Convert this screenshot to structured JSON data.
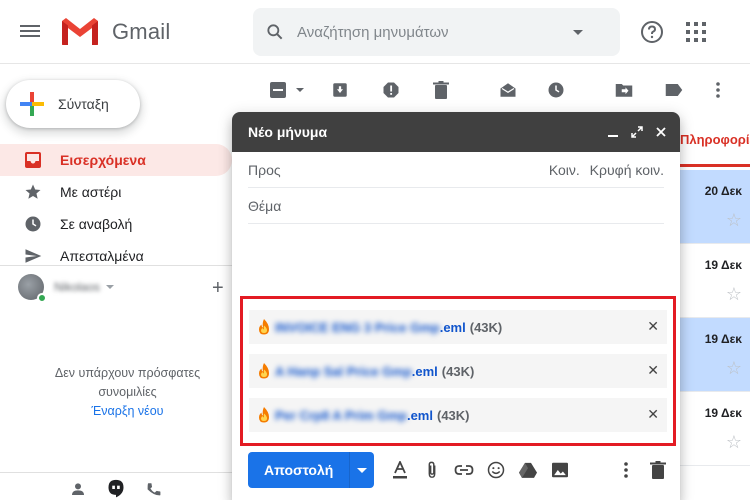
{
  "header": {
    "logo_text": "Gmail",
    "search_placeholder": "Αναζήτηση μηνυμάτων"
  },
  "nav": {
    "compose_label": "Σύνταξη",
    "items": [
      {
        "label": "Εισερχόμενα",
        "icon": "inbox-icon",
        "active": true
      },
      {
        "label": "Με αστέρι",
        "icon": "star-icon",
        "active": false
      },
      {
        "label": "Σε αναβολή",
        "icon": "clock-icon",
        "active": false
      },
      {
        "label": "Απεσταλμένα",
        "icon": "send-icon",
        "active": false
      }
    ]
  },
  "hangouts": {
    "user_name": "Nikolaos",
    "no_chats_text": "Δεν υπάρχουν πρόσφατες συνομιλίες",
    "start_new": "Έναρξη νέου"
  },
  "list": {
    "tab_label": "Πληροφορίες",
    "rows": [
      {
        "date": "20 Δεκ",
        "selected": true
      },
      {
        "date": "19 Δεκ",
        "selected": false
      },
      {
        "date": "19 Δεκ",
        "selected": true
      },
      {
        "date": "19 Δεκ",
        "selected": false
      }
    ]
  },
  "compose": {
    "title": "Νέο μήνυμα",
    "to_label": "Προς",
    "cc_label": "Κοιν.",
    "bcc_label": "Κρυφή κοιν.",
    "subject_label": "Θέμα",
    "send_label": "Αποστολή",
    "attachments": [
      {
        "name": "INVOICE ENG 3 Price Gmp",
        "ext": ".eml",
        "size": "(43K)"
      },
      {
        "name": "A Hanp Sal Price Gmp",
        "ext": ".eml",
        "size": "(43K)"
      },
      {
        "name": "Per Crp8 A Prim Gmp",
        "ext": ".eml",
        "size": "(43K)"
      }
    ]
  },
  "colors": {
    "accent_red": "#d93025",
    "send_blue": "#1a73e8",
    "highlight_border": "#e31b23"
  }
}
